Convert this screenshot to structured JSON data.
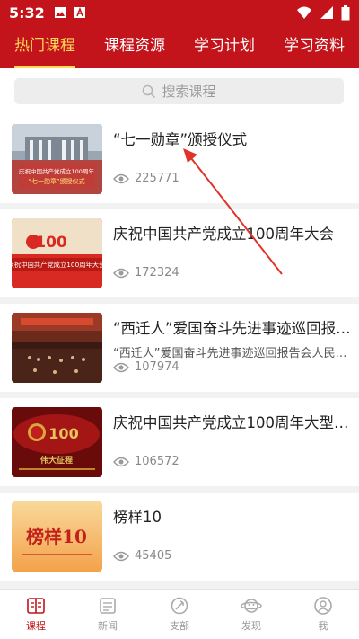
{
  "status_bar": {
    "time": "5:32",
    "left_icons": [
      "image-icon",
      "a-icon"
    ],
    "right_icons": [
      "wifi-icon",
      "signal-icon",
      "battery-icon"
    ]
  },
  "tabs": [
    {
      "label": "热门课程",
      "active": true
    },
    {
      "label": "课程资源",
      "active": false
    },
    {
      "label": "学习计划",
      "active": false
    },
    {
      "label": "学习资料",
      "active": false
    }
  ],
  "search": {
    "placeholder": "搜索课程"
  },
  "courses": [
    {
      "title": "“七一勋章”颁授仪式",
      "subtitle": "",
      "views": "225771",
      "thumb_text": [
        "庆祝中国共产党成立100周年",
        "“七一勋章”颁授仪式"
      ]
    },
    {
      "title": "庆祝中国共产党成立100周年大会",
      "subtitle": "",
      "views": "172324",
      "thumb_text": [
        "100",
        "庆祝中国共产党成立100周年大会"
      ]
    },
    {
      "title": "“西迁人”爱国奋斗先进事迹巡回报告...",
      "subtitle": "“西迁人”爱国奋斗先进事迹巡回报告会人民大会...",
      "views": "107974",
      "thumb_text": []
    },
    {
      "title": "庆祝中国共产党成立100周年大型情...",
      "subtitle": "",
      "views": "106572",
      "thumb_text": [
        "100",
        "伟大征程"
      ]
    },
    {
      "title": "榜样10",
      "subtitle": "",
      "views": "45405",
      "thumb_text": [
        "榜样10"
      ]
    }
  ],
  "bottom_nav": [
    {
      "label": "课程",
      "icon": "book-icon",
      "active": true
    },
    {
      "label": "新闻",
      "icon": "news-icon",
      "active": false
    },
    {
      "label": "支部",
      "icon": "party-icon",
      "active": false
    },
    {
      "label": "发现",
      "icon": "discover-icon",
      "active": false
    },
    {
      "label": "我",
      "icon": "user-icon",
      "active": false
    }
  ],
  "colors": {
    "brand": "#c2141a",
    "tab_active": "#ffd75a",
    "arrow": "#e0342a"
  }
}
